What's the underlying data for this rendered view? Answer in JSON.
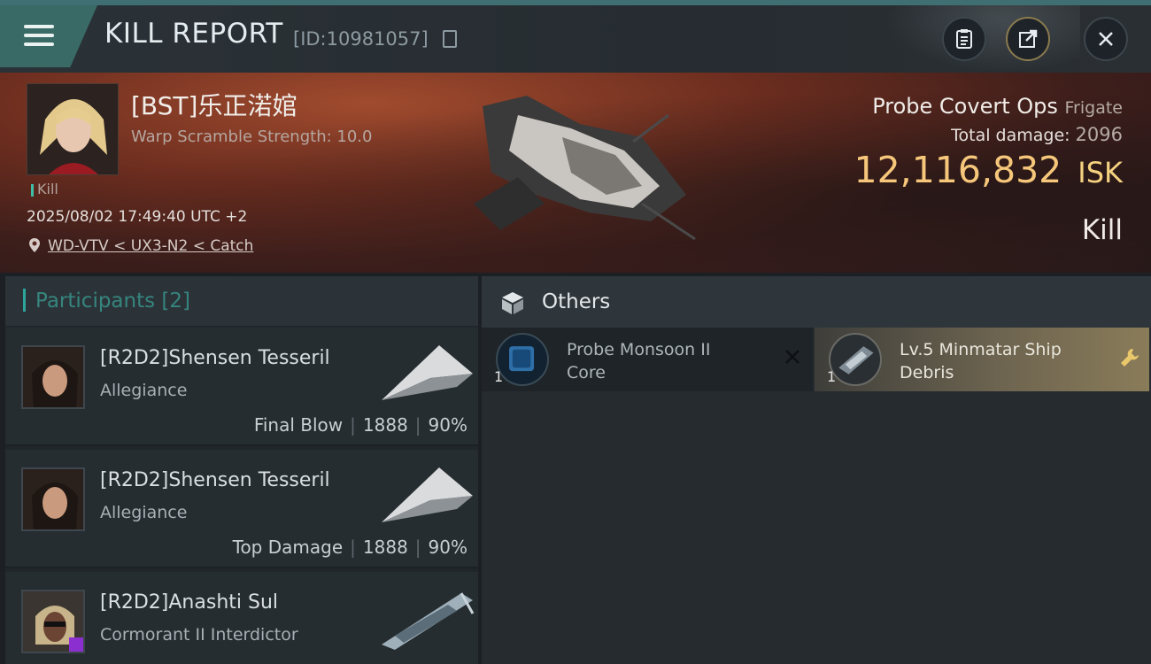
{
  "header": {
    "title": "KILL REPORT",
    "id_text": "[ID:10981057]"
  },
  "victim": {
    "name": "[BST]乐正渃婠",
    "warp_scramble": "Warp Scramble Strength: 10.0",
    "kill_tag": "Kill",
    "datetime": "2025/08/02 17:49:40 UTC +2",
    "location": "WD-VTV < UX3-N2 < Catch",
    "ship_name": "Probe Covert Ops",
    "ship_class": "Frigate",
    "total_damage_label": "Total damage:",
    "total_damage_value": "2096",
    "isk_value": "12,116,832",
    "isk_unit": "ISK",
    "result": "Kill"
  },
  "participants": {
    "title": "Participants",
    "count": "[2]",
    "rows": [
      {
        "name": "[R2D2]Shensen Tesseril",
        "ship": "Allegiance",
        "role": "Final Blow",
        "damage": "1888",
        "percent": "90%"
      },
      {
        "name": "[R2D2]Shensen Tesseril",
        "ship": "Allegiance",
        "role": "Top Damage",
        "damage": "1888",
        "percent": "90%"
      },
      {
        "name": "[R2D2]Anashti Sul",
        "ship": "Cormorant II Interdictor"
      }
    ]
  },
  "others": {
    "title": "Others",
    "items": [
      {
        "qty": "1",
        "name": "Probe Monsoon II Core"
      },
      {
        "qty": "1",
        "name": "Lv.5 Minmatar Ship Debris"
      }
    ]
  },
  "colors": {
    "accent_teal": "#3a6a66",
    "isk_gold": "#f6c77b",
    "banner_red": "#6c2d1f"
  }
}
